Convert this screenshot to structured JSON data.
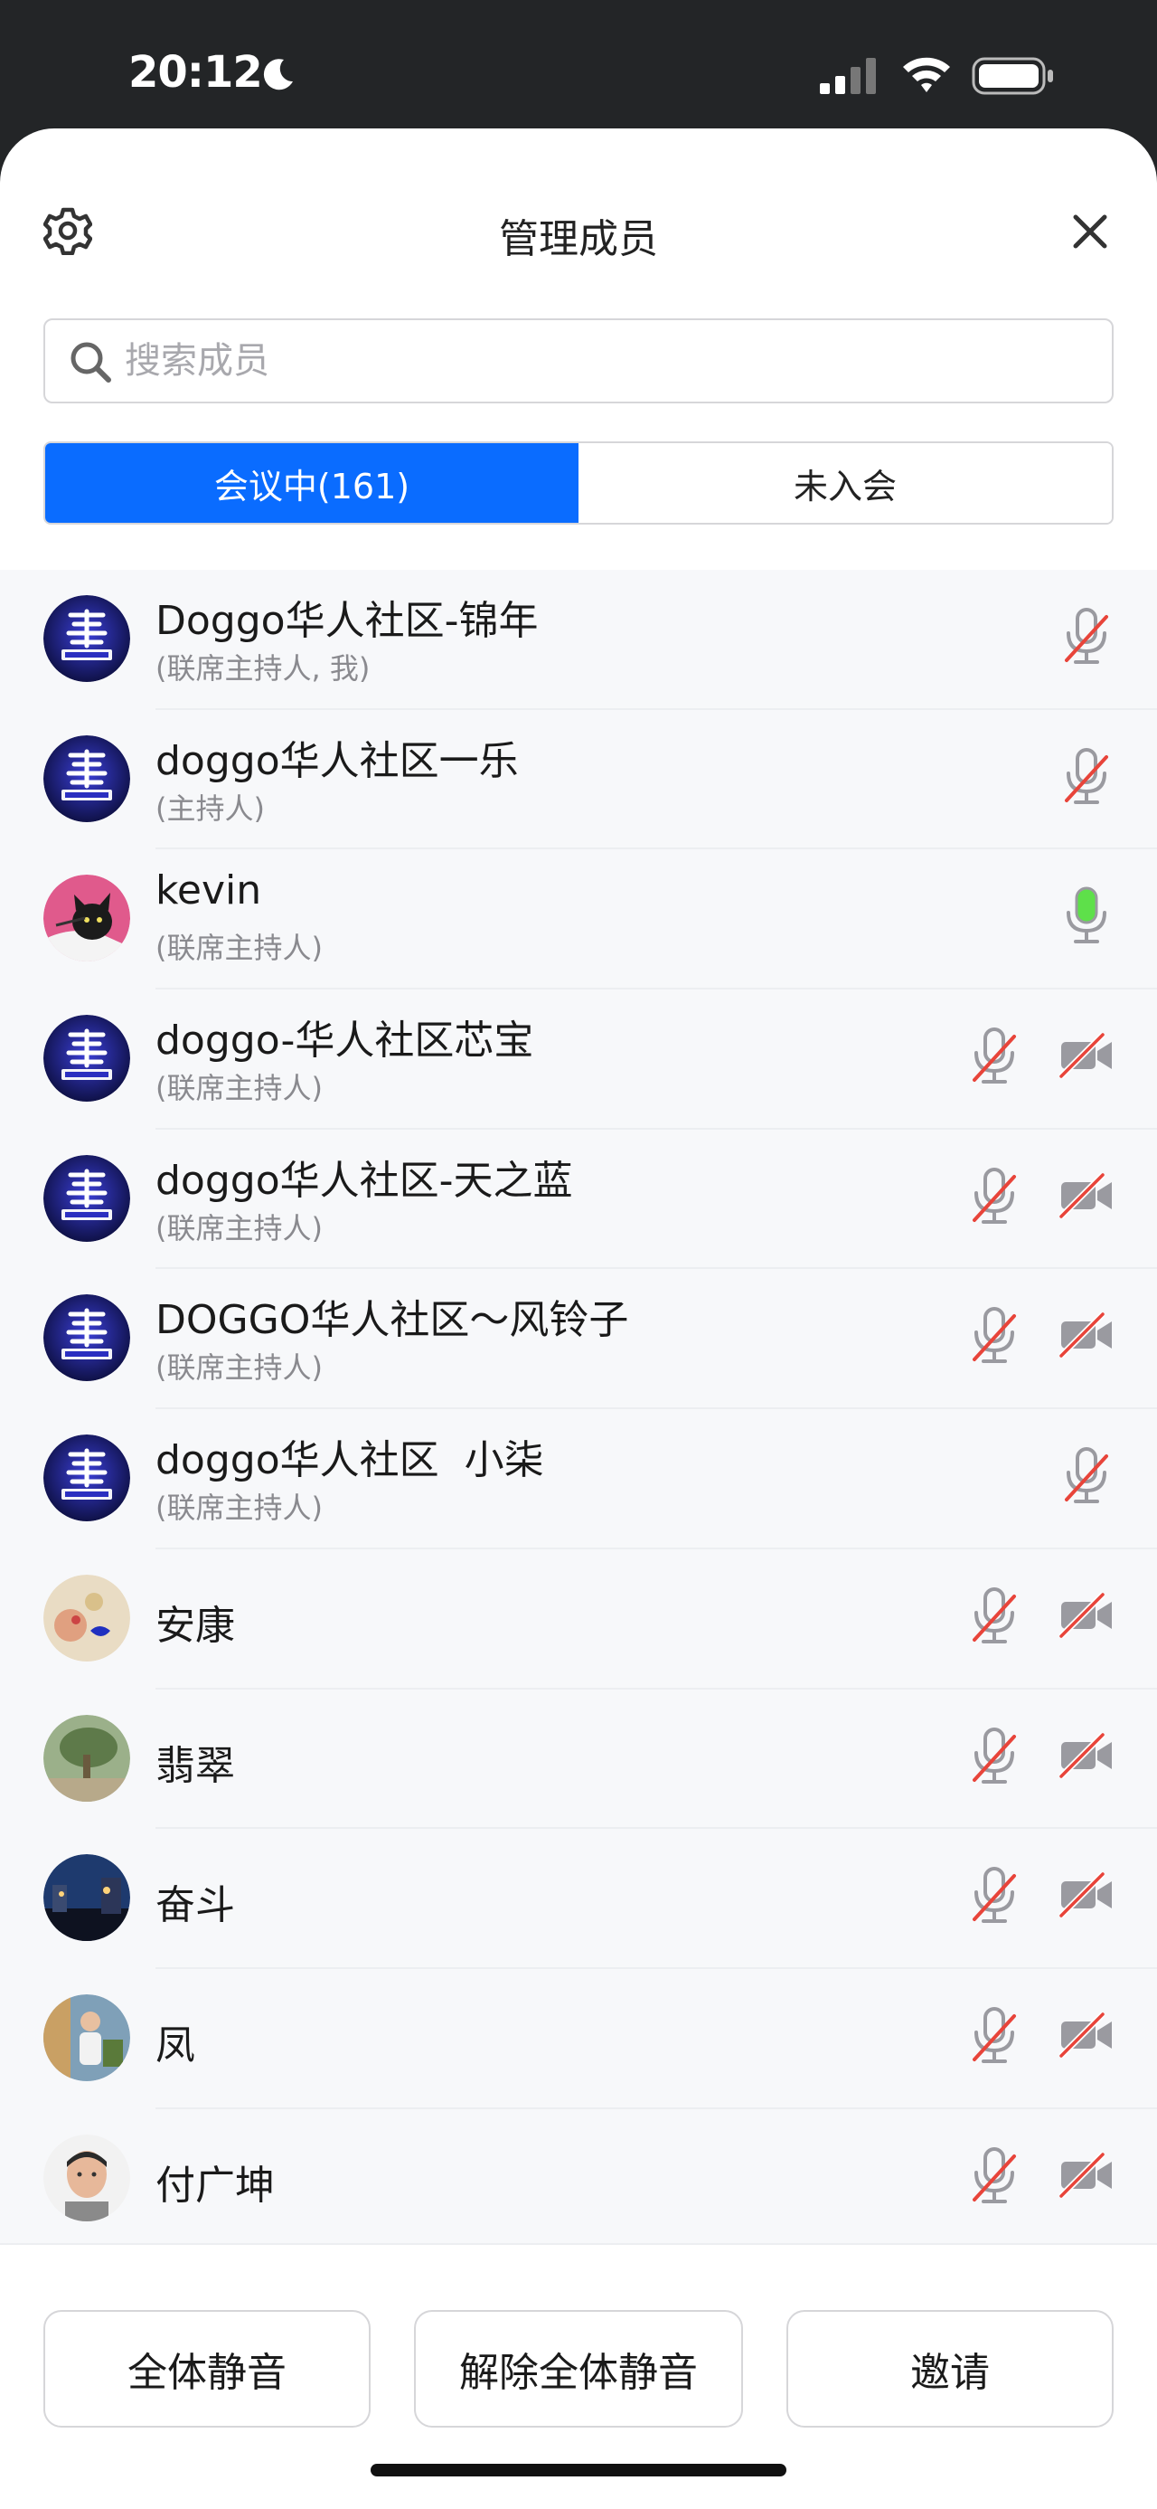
{
  "status_bar": {
    "time": "20:12"
  },
  "header": {
    "title": "管理成员"
  },
  "search": {
    "placeholder": "搜索成员"
  },
  "tabs": [
    {
      "label": "会议中(161)",
      "active": true
    },
    {
      "label": "未入会",
      "active": false
    }
  ],
  "members": [
    {
      "name": "Doggo华人社区-锦年",
      "role": "(联席主持人, 我)",
      "avatar": "community-logo",
      "mic": "muted",
      "camera": "none"
    },
    {
      "name": "doggo华人社区一乐",
      "role": "(主持人)",
      "avatar": "community-logo",
      "mic": "muted",
      "camera": "none"
    },
    {
      "name": "kevin",
      "role": "(联席主持人)",
      "avatar": "cat-photo",
      "mic": "active",
      "camera": "none"
    },
    {
      "name": "doggo-华人社区芯宝",
      "role": "(联席主持人)",
      "avatar": "community-logo",
      "mic": "muted",
      "camera": "off"
    },
    {
      "name": "doggo华人社区-天之蓝",
      "role": "(联席主持人)",
      "avatar": "community-logo",
      "mic": "muted",
      "camera": "off"
    },
    {
      "name": "DOGGO华人社区～风铃子",
      "role": "(联席主持人)",
      "avatar": "community-logo",
      "mic": "muted",
      "camera": "off"
    },
    {
      "name": "doggo华人社区  小柒",
      "role": "(联席主持人)",
      "avatar": "community-logo",
      "mic": "muted",
      "camera": "none"
    },
    {
      "name": "安康",
      "role": "",
      "avatar": "photo-anking",
      "mic": "muted",
      "camera": "off"
    },
    {
      "name": "翡翠",
      "role": "",
      "avatar": "photo-tree",
      "mic": "muted",
      "camera": "off"
    },
    {
      "name": "奋斗",
      "role": "",
      "avatar": "photo-night",
      "mic": "muted",
      "camera": "off"
    },
    {
      "name": "凤",
      "role": "",
      "avatar": "photo-people",
      "mic": "muted",
      "camera": "off"
    },
    {
      "name": "付广坤",
      "role": "",
      "avatar": "photo-man",
      "mic": "muted",
      "camera": "off"
    }
  ],
  "footer": {
    "mute_all": "全体静音",
    "unmute_all": "解除全体静音",
    "invite": "邀请"
  },
  "colors": {
    "accent": "#0a6cff",
    "mic_active": "#5ee04a",
    "muted_slash": "#e8443a"
  },
  "icons": [
    "settings-gear-icon",
    "close-icon",
    "search-icon",
    "microphone-icon",
    "camera-off-icon",
    "moon-icon",
    "signal-icon",
    "wifi-icon",
    "battery-icon"
  ]
}
